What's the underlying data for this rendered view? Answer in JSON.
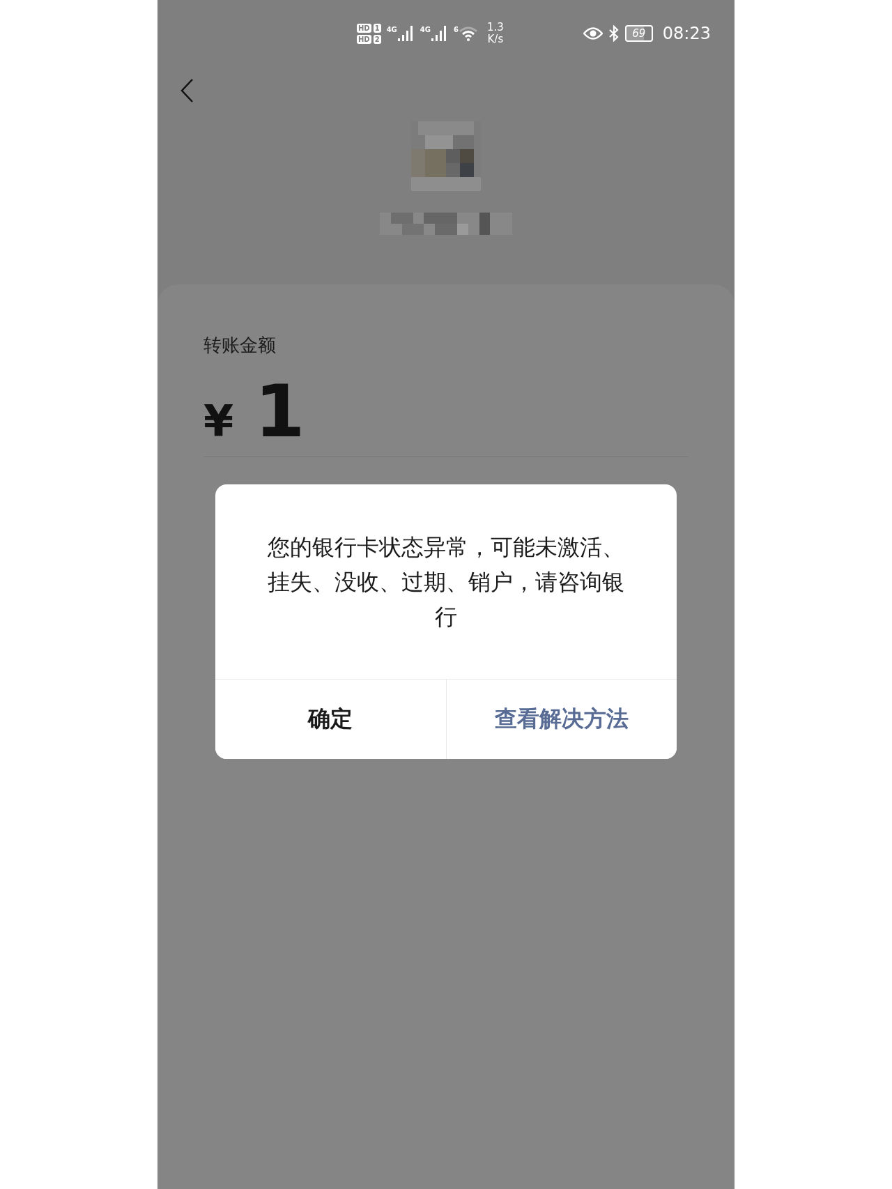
{
  "status_bar": {
    "sims": [
      {
        "label": "HD",
        "slot": "1"
      },
      {
        "label": "HD",
        "slot": "2"
      }
    ],
    "networks": [
      "4G",
      "4G"
    ],
    "wifi_label": "6",
    "speed": [
      "1.3",
      "K/s"
    ],
    "battery": "69",
    "time": "08:23"
  },
  "amount": {
    "label": "转账金额",
    "currency": "¥",
    "value": "1"
  },
  "dialog": {
    "message": "您的银行卡状态异常，可能未激活、挂失、没收、过期、销户，请咨询银行",
    "buttons": [
      {
        "label": "确定",
        "kind": "default"
      },
      {
        "label": "查看解决方法",
        "kind": "primary"
      }
    ]
  }
}
